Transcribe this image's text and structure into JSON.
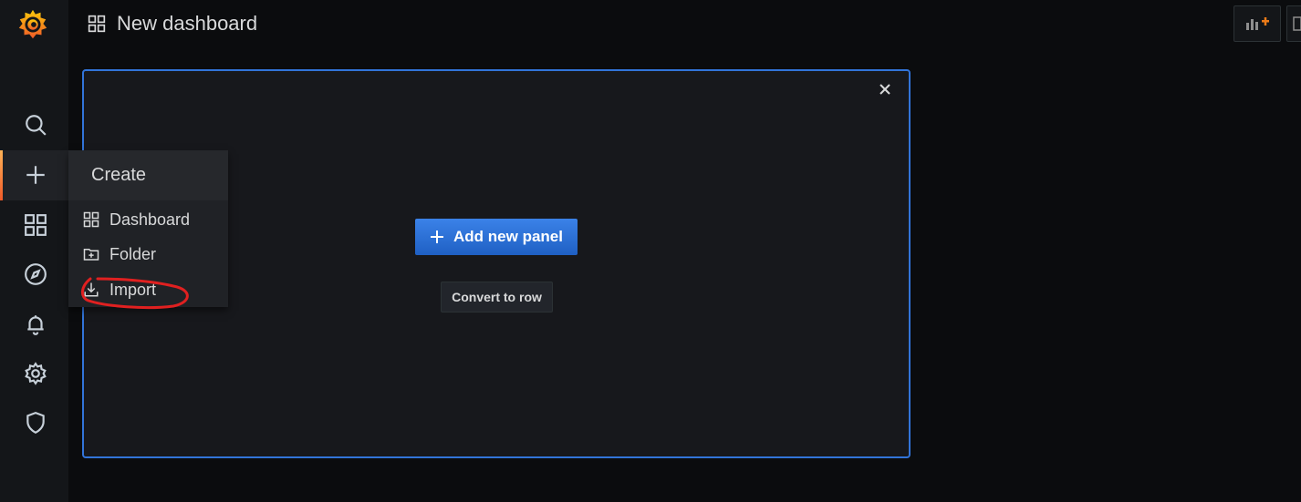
{
  "app": {
    "title": "New dashboard"
  },
  "sidebar": {
    "items": [
      {
        "name": "search",
        "icon": "search-icon"
      },
      {
        "name": "create",
        "icon": "plus-icon",
        "active": true
      },
      {
        "name": "dashboards",
        "icon": "apps-icon"
      },
      {
        "name": "explore",
        "icon": "compass-icon"
      },
      {
        "name": "alerting",
        "icon": "bell-icon"
      },
      {
        "name": "configuration",
        "icon": "gear-icon"
      },
      {
        "name": "server-admin",
        "icon": "shield-icon"
      }
    ]
  },
  "create_menu": {
    "header": "Create",
    "items": [
      {
        "label": "Dashboard",
        "icon": "apps-icon"
      },
      {
        "label": "Folder",
        "icon": "folder-plus-icon"
      },
      {
        "label": "Import",
        "icon": "import-icon"
      }
    ]
  },
  "panel": {
    "add_button_label": "Add new panel",
    "convert_button_label": "Convert to row"
  },
  "colors": {
    "accent": "#3274d9",
    "brand": "#f05a28",
    "annotation": "#e02020"
  }
}
